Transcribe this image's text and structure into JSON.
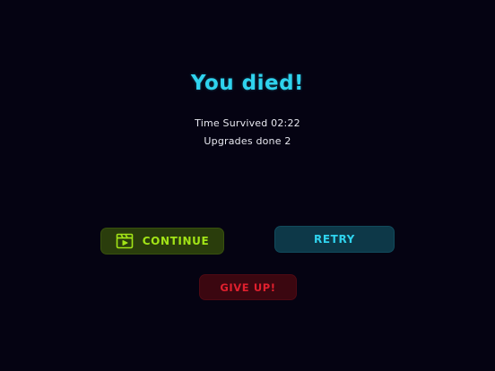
{
  "colors": {
    "background": "#050312",
    "title": "#2fd3ee",
    "continue_text": "#a2e417",
    "continue_bg": "#2a3d0c",
    "retry_text": "#2fd3ee",
    "retry_bg": "#0d3848",
    "giveup_text": "#e0202e",
    "giveup_bg": "#3b0710"
  },
  "death_screen": {
    "title": "You died!",
    "time_survived": "Time Survived 02:22",
    "upgrades_done": "Upgrades done 2"
  },
  "buttons": {
    "continue": {
      "label": "CONTINUE",
      "icon": "video-clapper-icon"
    },
    "retry": {
      "label": "RETRY"
    },
    "give_up": {
      "label": "GIVE UP!"
    }
  }
}
